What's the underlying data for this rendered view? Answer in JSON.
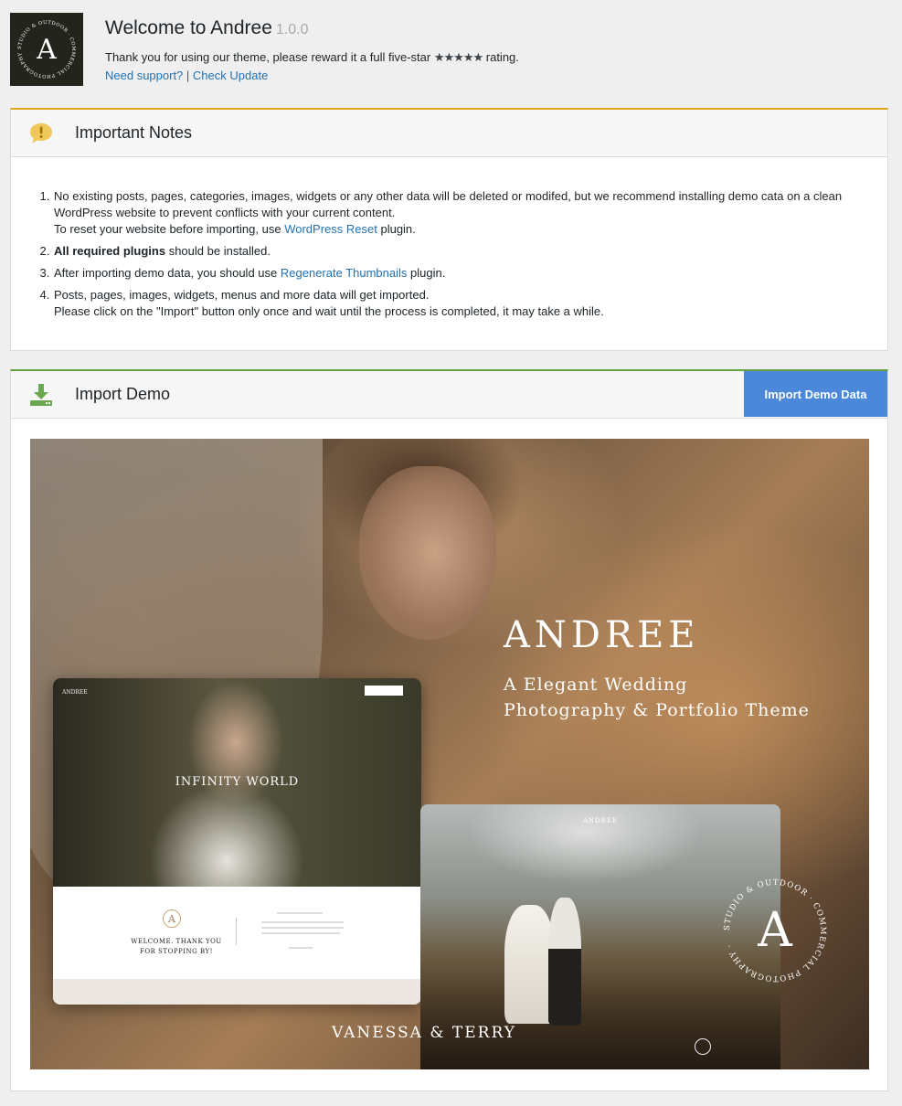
{
  "header": {
    "title": "Welcome to Andree",
    "version": "1.0.0",
    "desc_before": "Thank you for using our theme, please reward it a full five-star",
    "stars": "★★★★★",
    "desc_after": "rating.",
    "support_link": "Need support?",
    "separator": "|",
    "update_link": "Check Update"
  },
  "notes": {
    "title": "Important Notes",
    "item1_line1": "No existing posts, pages, categories, images, widgets or any other data will be deleted or modifed, but we recommend installing demo cata on a clean WordPress website to prevent conflicts with your current content.",
    "item1_line2_before": "To reset your website before importing, use",
    "item1_link": "WordPress Reset",
    "item1_line2_after": "plugin.",
    "item2_bold": "All required plugins",
    "item2_rest": "should be installed.",
    "item3_before": "After importing demo data, you should use",
    "item3_link": "Regenerate Thumbnails",
    "item3_after": "plugin.",
    "item4_line1": "Posts, pages, images, widgets, menus and more data will get imported.",
    "item4_line2": "Please click on the \"Import\" button only once and wait until the process is completed, it may take a while."
  },
  "import": {
    "title": "Import Demo",
    "button": "Import Demo Data"
  },
  "preview": {
    "brand": "ANDREE",
    "subtitle_line1": "A Elegant Wedding",
    "subtitle_line2": "Photography & Portfolio Theme",
    "shot1_logo": "ANDREE",
    "shot1_hero": "INFINITY WORLD",
    "shot1_welcome": "WELCOME. THANK YOU FOR STOPPING BY!",
    "shot1_mark": "A",
    "shot2_logo": "ANDREE",
    "shot2_title": "VANESSA & TERRY",
    "seal_letter": "A",
    "seal_ring": "STUDIO & OUTDOOR · COMMERCIAL PHOTOGRAPHY ·"
  },
  "colors": {
    "link": "#2271b1",
    "notes_accent": "#dba617",
    "import_accent": "#68a040",
    "button_bg": "#4b88d9"
  }
}
